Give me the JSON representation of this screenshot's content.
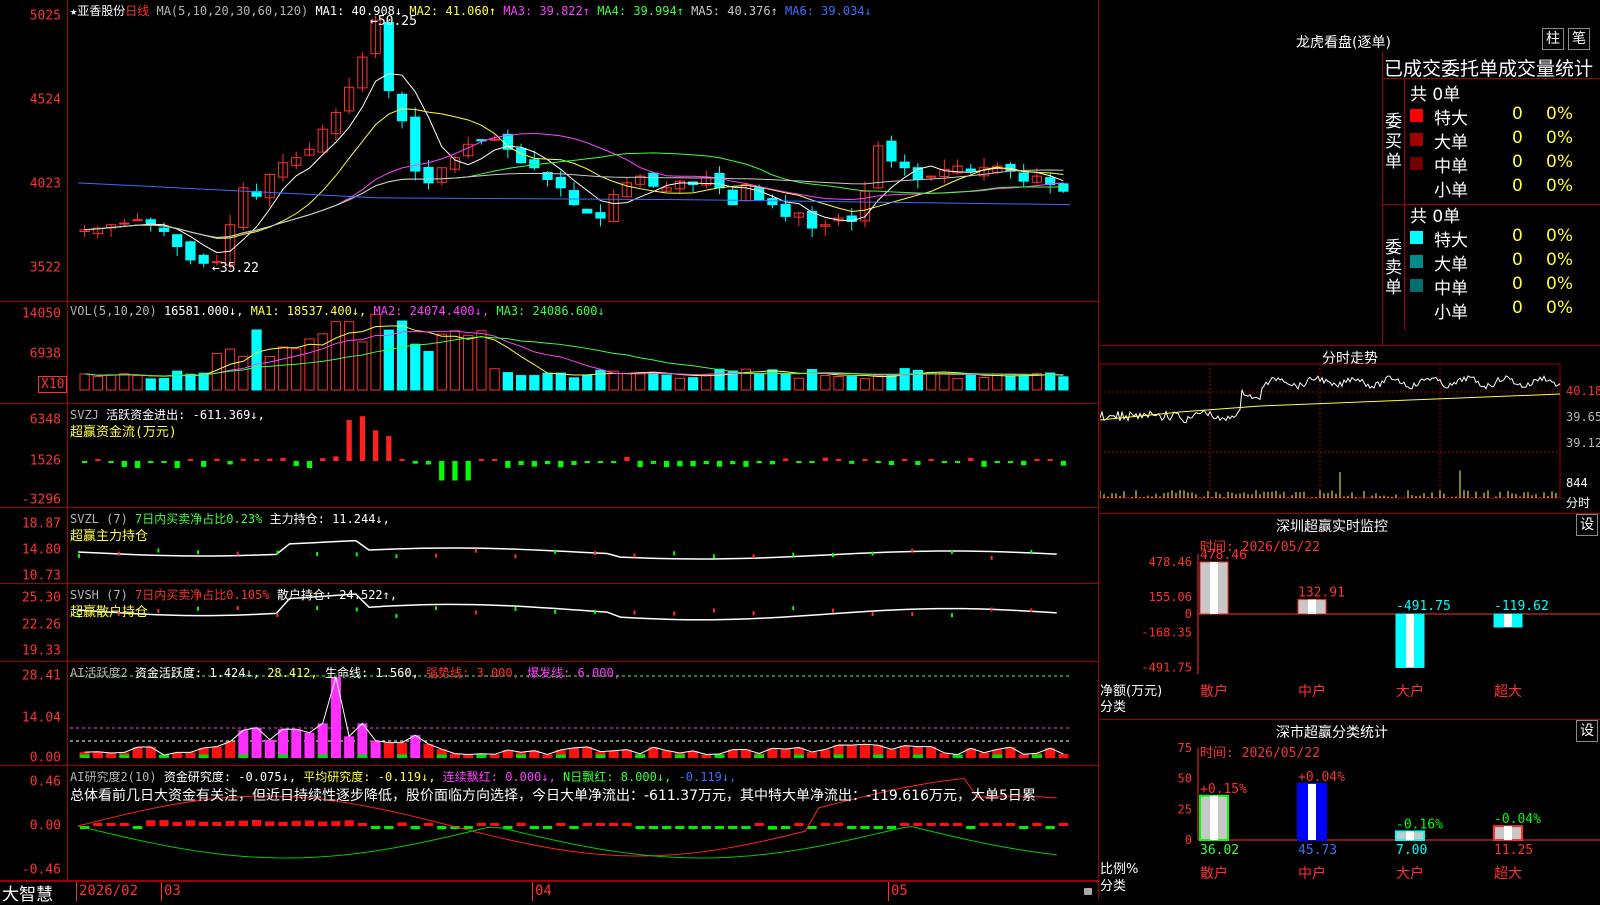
{
  "stock": {
    "name": "★亚香股份",
    "period": "日线"
  },
  "main_pane": {
    "ma_header": "MA(5,10,20,30,60,120)",
    "ma": [
      {
        "label": "MA1: 40.908↓",
        "color": "#ffffff"
      },
      {
        "label": "MA2: 41.060↑",
        "color": "#ffff3c"
      },
      {
        "label": "MA3: 39.822↑",
        "color": "#ff40ff"
      },
      {
        "label": "MA4: 39.994↑",
        "color": "#3cff3c"
      },
      {
        "label": "MA5: 40.376↑",
        "color": "#c8c8c8"
      },
      {
        "label": "MA6: 39.034↓",
        "color": "#3c6cff"
      }
    ],
    "y_ticks": [
      "5025",
      "4524",
      "4023",
      "3522"
    ],
    "high_label": "50.25",
    "low_label": "35.22"
  },
  "vol_pane": {
    "header": "VOL(5,10,20)",
    "val": "16581.000↓",
    "ma1": "MA1: 18537.400↓",
    "ma2": "MA2: 24074.400↓",
    "ma3": "MA3: 24086.600↓",
    "y_ticks": [
      "14050",
      "6938"
    ],
    "unit": "X10"
  },
  "svzj_pane": {
    "header": "SVZJ",
    "text": "活跃资金进出: -611.369↓,",
    "sub": "超赢资金流(万元)",
    "y_ticks": [
      "6348",
      "1526",
      "-3296"
    ]
  },
  "svzl_pane": {
    "header": "SVZL (7)",
    "text1": "7日内买卖净占比0.23%",
    "text2": "主力持仓: 11.244↓,",
    "sub": "超赢主力持仓",
    "y_ticks": [
      "18.87",
      "14.80",
      "10.73"
    ]
  },
  "svsh_pane": {
    "header": "SVSH (7)",
    "text1": "7日内买卖净占比0.105%",
    "text2": "散户持仓: 24.522↑,",
    "sub": "超赢散户持仓",
    "y_ticks": [
      "25.30",
      "22.26",
      "19.33"
    ]
  },
  "ai_pane": {
    "header": "AI活跃度2",
    "text1": "资金活跃度: 1.424↓,",
    "text2": "28.412,",
    "text3": "生命线: 1.560,",
    "text4": "强势线: 3.000,",
    "text5": "爆发线: 6.000,",
    "y_ticks": [
      "28.41",
      "14.04",
      "0.00"
    ]
  },
  "ai2_pane": {
    "header": "AI研究度2(10)",
    "text1": "资金研究度: -0.075↓,",
    "text2": "平均研究度: -0.119↓,",
    "text3": "连续飘红: 0.000↓,",
    "text4": "N日飘红: 8.000↓,",
    "text5": "-0.119↓,",
    "summary": "总体看前几日大资金有关注，但近日持续性逐步降低，股价面临方向选择，今日大单净流出：-611.37万元，其中特大单净流出：-119.616万元，大单5日累",
    "y_ticks": [
      "0.46",
      "0.00",
      "-0.46"
    ]
  },
  "bottom_axis": {
    "logo": "大智慧",
    "dates": [
      "2026/02",
      "03",
      "04",
      "05"
    ]
  },
  "dragon": {
    "title": "龙虎看盘(逐单)",
    "tabs": [
      "柱",
      "笔"
    ],
    "subtitle": "已成交委托单成交量统计",
    "buy": {
      "label": "委买单",
      "total": "共 0单",
      "rows": [
        {
          "name": "特大",
          "val": "0",
          "pct": "0%",
          "color": "#ff0000"
        },
        {
          "name": "大单",
          "val": "0",
          "pct": "0%",
          "color": "#a00000"
        },
        {
          "name": "中单",
          "val": "0",
          "pct": "0%",
          "color": "#700000"
        },
        {
          "name": "小单",
          "val": "0",
          "pct": "0%",
          "color": ""
        }
      ]
    },
    "sell": {
      "label": "委卖单",
      "total": "共 0单",
      "rows": [
        {
          "name": "特大",
          "val": "0",
          "pct": "0%",
          "color": "#00ffff"
        },
        {
          "name": "大单",
          "val": "0",
          "pct": "0%",
          "color": "#008a8a"
        },
        {
          "name": "中单",
          "val": "0",
          "pct": "0%",
          "color": "#006e6e"
        },
        {
          "name": "小单",
          "val": "0",
          "pct": "0%",
          "color": ""
        }
      ]
    }
  },
  "intraday": {
    "title": "分时走势",
    "y_ticks": [
      "40.18",
      "39.65",
      "39.12"
    ],
    "vol_tick": "844",
    "vol_unit": "分时"
  },
  "sz_monitor": {
    "title": "深圳超赢实时监控",
    "btn": "设",
    "time": "时间: 2026/05/22",
    "y_ticks": [
      "478.46",
      "155.06",
      "0",
      "-168.35",
      "-491.75"
    ],
    "ylabel": "净额(万元)",
    "xlabel": "分类",
    "bars": [
      {
        "cat": "散户",
        "value": "478.46"
      },
      {
        "cat": "中户",
        "value": "132.91"
      },
      {
        "cat": "大户",
        "value": "-491.75"
      },
      {
        "cat": "超大",
        "value": "-119.62"
      }
    ]
  },
  "sh_stats": {
    "title": "深市超赢分类统计",
    "btn": "设",
    "time": "时间: 2026/05/22",
    "y_ticks": [
      "75",
      "50",
      "25",
      "0"
    ],
    "ylabel": "比例%",
    "xlabel": "分类",
    "bars": [
      {
        "cat": "散户",
        "value": "36.02",
        "change": "+0.15%"
      },
      {
        "cat": "中户",
        "value": "45.73",
        "change": "+0.04%"
      },
      {
        "cat": "大户",
        "value": "7.00",
        "change": "-0.16%"
      },
      {
        "cat": "超大",
        "value": "11.25",
        "change": "-0.04%"
      }
    ]
  }
}
